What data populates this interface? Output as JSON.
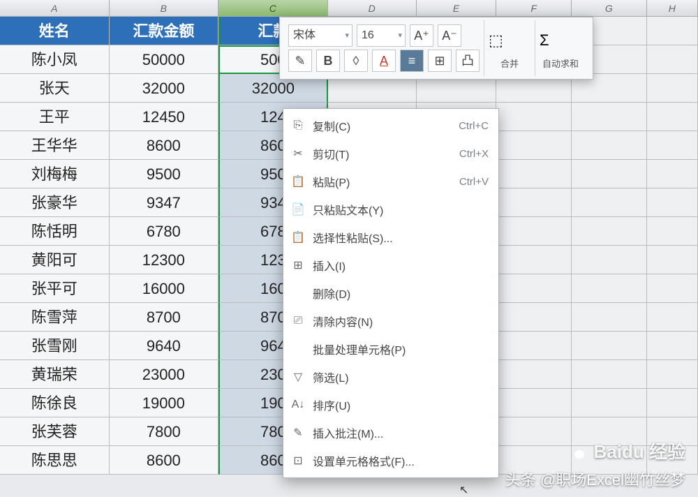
{
  "columns": [
    "A",
    "B",
    "C",
    "D",
    "E",
    "F",
    "G",
    "H"
  ],
  "header_row": {
    "A": "姓名",
    "B": "汇款金额",
    "C": "汇款"
  },
  "rows": [
    {
      "A": "陈小凤",
      "B": "50000",
      "C": "500"
    },
    {
      "A": "张天",
      "B": "32000",
      "C": "32000"
    },
    {
      "A": "王平",
      "B": "12450",
      "C": "124"
    },
    {
      "A": "王华华",
      "B": "8600",
      "C": "860"
    },
    {
      "A": "刘梅梅",
      "B": "9500",
      "C": "950"
    },
    {
      "A": "张豪华",
      "B": "9347",
      "C": "934"
    },
    {
      "A": "陈恬明",
      "B": "6780",
      "C": "678"
    },
    {
      "A": "黄阳可",
      "B": "12300",
      "C": "123"
    },
    {
      "A": "张平可",
      "B": "16000",
      "C": "160"
    },
    {
      "A": "陈雪萍",
      "B": "8700",
      "C": "870"
    },
    {
      "A": "张雪刚",
      "B": "9640",
      "C": "964"
    },
    {
      "A": "黄瑞荣",
      "B": "23000",
      "C": "230"
    },
    {
      "A": "陈徐良",
      "B": "19000",
      "C": "190"
    },
    {
      "A": "张芙蓉",
      "B": "7800",
      "C": "780"
    },
    {
      "A": "陈思思",
      "B": "8600",
      "C": "860"
    }
  ],
  "selected_column": "C",
  "active_cell": "C2",
  "mini_toolbar": {
    "font": "宋体",
    "size": "16",
    "merge_label": "合并",
    "autosum_label": "自动求和"
  },
  "context_menu": [
    {
      "icon": "⎘",
      "label": "复制(C)",
      "shortcut": "Ctrl+C"
    },
    {
      "icon": "✂",
      "label": "剪切(T)",
      "shortcut": "Ctrl+X"
    },
    {
      "icon": "📋",
      "label": "粘贴(P)",
      "shortcut": "Ctrl+V"
    },
    {
      "icon": "📄",
      "label": "只粘贴文本(Y)",
      "shortcut": ""
    },
    {
      "icon": "📋",
      "label": "选择性粘贴(S)...",
      "shortcut": ""
    },
    {
      "icon": "⊞",
      "label": "插入(I)",
      "shortcut": ""
    },
    {
      "icon": "",
      "label": "删除(D)",
      "shortcut": ""
    },
    {
      "icon": "⎚",
      "label": "清除内容(N)",
      "shortcut": ""
    },
    {
      "icon": "",
      "label": "批量处理单元格(P)",
      "shortcut": ""
    },
    {
      "icon": "▽",
      "label": "筛选(L)",
      "shortcut": ""
    },
    {
      "icon": "A↓",
      "label": "排序(U)",
      "shortcut": ""
    },
    {
      "icon": "✎",
      "label": "插入批注(M)...",
      "shortcut": ""
    },
    {
      "icon": "⊡",
      "label": "设置单元格格式(F)...",
      "shortcut": ""
    }
  ],
  "watermark1": "Baidu 经验",
  "watermark2": "头条 @职场Excel幽竹丝梦",
  "chart_data": {
    "type": "table",
    "title": "汇款金额",
    "columns": [
      "姓名",
      "汇款金额"
    ],
    "rows": [
      [
        "陈小凤",
        50000
      ],
      [
        "张天",
        32000
      ],
      [
        "王平",
        12450
      ],
      [
        "王华华",
        8600
      ],
      [
        "刘梅梅",
        9500
      ],
      [
        "张豪华",
        9347
      ],
      [
        "陈恬明",
        6780
      ],
      [
        "黄阳可",
        12300
      ],
      [
        "张平可",
        16000
      ],
      [
        "陈雪萍",
        8700
      ],
      [
        "张雪刚",
        9640
      ],
      [
        "黄瑞荣",
        23000
      ],
      [
        "陈徐良",
        19000
      ],
      [
        "张芙蓉",
        7800
      ],
      [
        "陈思思",
        8600
      ]
    ]
  }
}
